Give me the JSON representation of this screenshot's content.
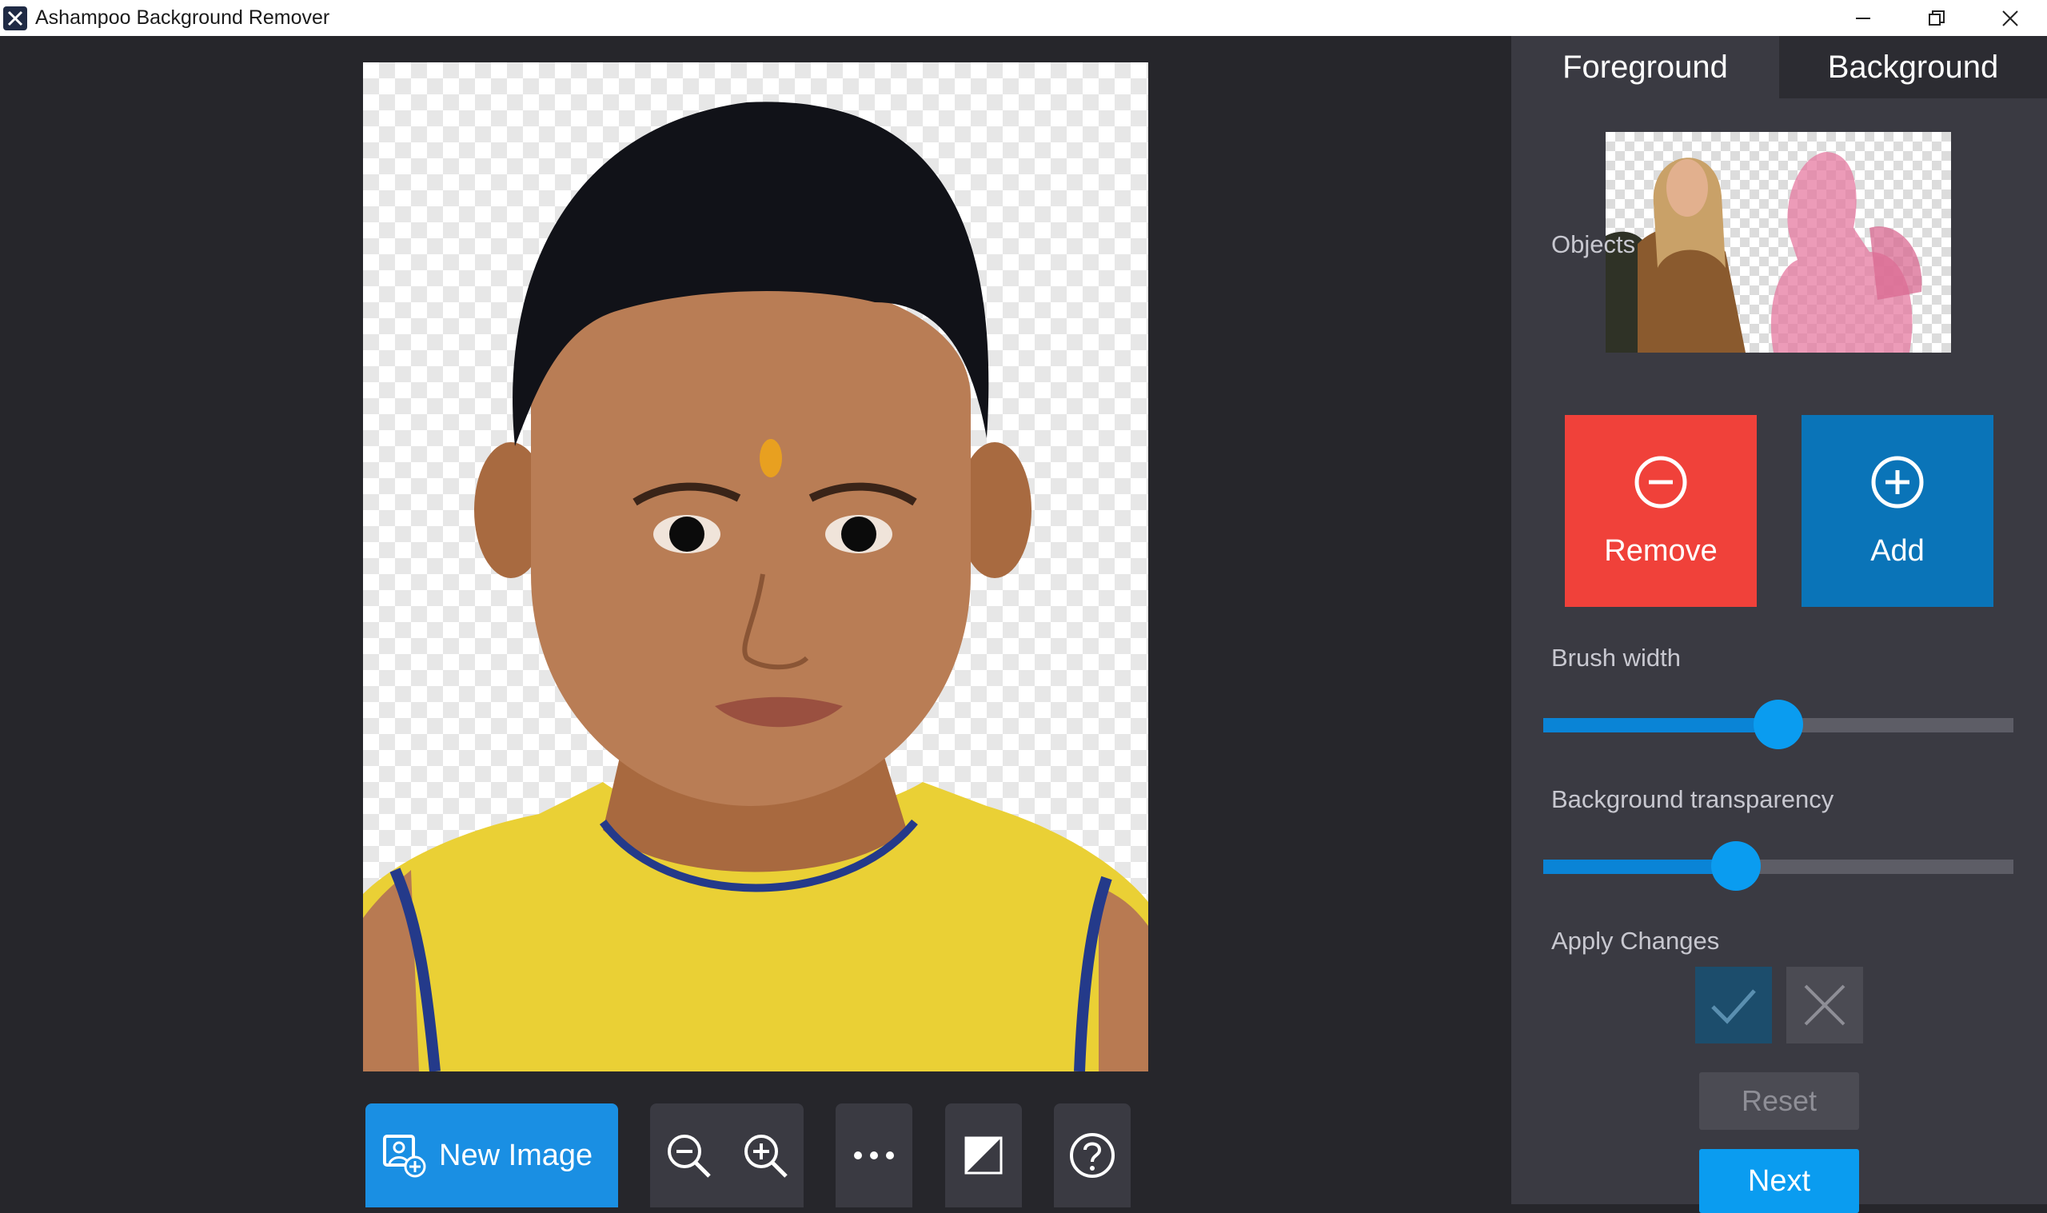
{
  "window": {
    "title": "Ashampoo Background Remover",
    "controls": [
      "minimize-icon",
      "restore-icon",
      "close-icon"
    ]
  },
  "toolbar": {
    "new_image_label": "New Image",
    "icons": [
      "new-image-icon",
      "zoom-out-icon",
      "zoom-in-icon",
      "more-icon",
      "compare-icon",
      "help-icon"
    ]
  },
  "panel": {
    "tabs": [
      {
        "label": "Foreground",
        "active": true
      },
      {
        "label": "Background",
        "active": false
      }
    ],
    "objects_label": "Objects",
    "remove_label": "Remove",
    "add_label": "Add",
    "brush_width_label": "Brush width",
    "brush_width_value": 0.5,
    "bg_transparency_label": "Background transparency",
    "bg_transparency_value": 0.41,
    "apply_changes_label": "Apply Changes",
    "reset_label": "Reset",
    "next_label": "Next"
  },
  "colors": {
    "accent": "#0a9cf0",
    "remove": "#f0413a",
    "add": "#0a74b8",
    "panel_bg": "#3a3a42",
    "canvas_bg": "#26262b"
  }
}
